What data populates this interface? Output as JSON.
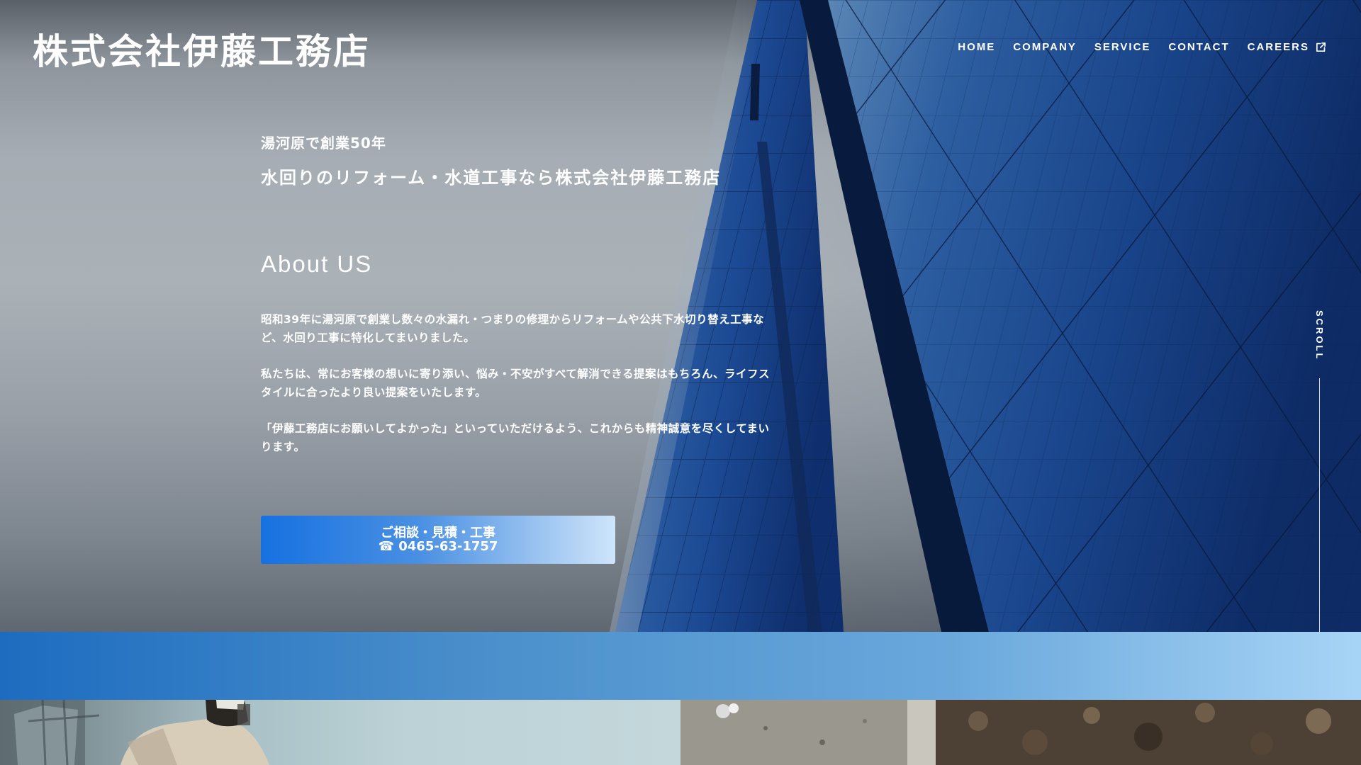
{
  "header": {
    "logo": "株式会社伊藤工務店",
    "nav": [
      {
        "label": "HOME"
      },
      {
        "label": "COMPANY"
      },
      {
        "label": "SERVICE"
      },
      {
        "label": "CONTACT"
      },
      {
        "label": "CAREERS",
        "icon": "external-link-icon"
      }
    ]
  },
  "hero": {
    "subtitle": "湯河原で創業50年",
    "headline": "水回りのリフォーム・水道工事なら株式会社伊藤工務店",
    "about_title": "About US",
    "paragraphs": [
      "昭和39年に湯河原で創業し数々の水漏れ・つまりの修理からリフォームや公共下水切り替え工事など、水回り工事に特化してまいりました。",
      "私たちは、常にお客様の想いに寄り添い、悩み・不安がすべて解消できる提案はもちろん、ライフスタイルに合ったより良い提案をいたします。",
      "「伊藤工務店にお願いしてよかった」といっていただけるよう、これからも精神誠意を尽くしてまいります。"
    ],
    "cta": {
      "line1": "ご相談・見積・工事",
      "line2": "☎ 0465-63-1757"
    },
    "scroll_label": "SCROLL"
  },
  "colors": {
    "accent_blue": "#1671e1",
    "band_start": "#1d6cc0",
    "band_end": "#a7d4f6"
  }
}
